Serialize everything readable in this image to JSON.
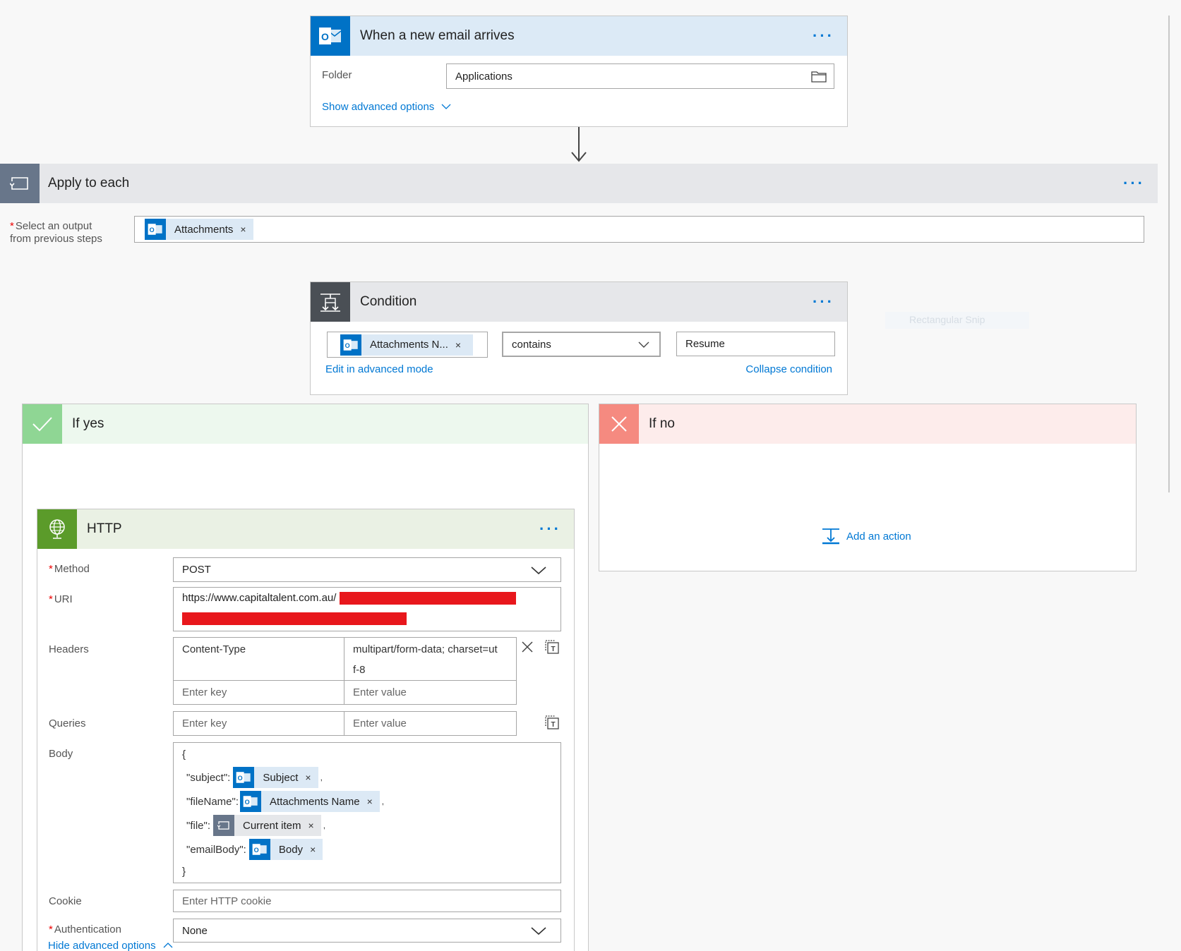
{
  "trigger": {
    "title": "When a new email arrives",
    "folder_label": "Folder",
    "folder_value": "Applications",
    "advanced_link": "Show advanced options"
  },
  "apply_each": {
    "title": "Apply to each",
    "select_label_line1": "Select an output",
    "select_label_line2": "from previous steps",
    "token": "Attachments"
  },
  "condition": {
    "title": "Condition",
    "token": "Attachments N...",
    "operator": "contains",
    "value": "Resume",
    "edit_link": "Edit in advanced mode",
    "collapse_link": "Collapse condition"
  },
  "ghost_text": "Rectangular Snip",
  "if_yes": {
    "title": "If yes"
  },
  "if_no": {
    "title": "If no",
    "add_action": "Add an action"
  },
  "http": {
    "title": "HTTP",
    "method_label": "Method",
    "method_value": "POST",
    "uri_label": "URI",
    "uri_value": "https://www.capitaltalent.com.au/",
    "headers_label": "Headers",
    "header_key": "Content-Type",
    "header_value_line1": "multipart/form-data; charset=ut",
    "header_value_line2": "f-8",
    "key_placeholder": "Enter key",
    "value_placeholder": "Enter value",
    "queries_label": "Queries",
    "body_label": "Body",
    "body_open": "{",
    "body_close": "}",
    "body_subject_key": "\"subject\":",
    "body_subject_token": "Subject",
    "body_filename_key": "\"fileName\":",
    "body_filename_token": "Attachments Name",
    "body_file_key": "\"file\":",
    "body_file_token": "Current item",
    "body_emailbody_key": "\"emailBody\":",
    "body_emailbody_token": "Body",
    "comma": ",",
    "cookie_label": "Cookie",
    "cookie_placeholder": "Enter HTTP cookie",
    "auth_label": "Authentication",
    "auth_value": "None",
    "hide_link": "Hide advanced options"
  },
  "colors": {
    "outlook_blue": "#0072c6",
    "link_blue": "#0078d4",
    "trigger_header": "#dceaf6",
    "gray_header": "#e6e7ea",
    "yes_green": "#8fd694",
    "no_red": "#f58a80",
    "http_green": "#5b9b2a",
    "redaction": "#e8171c"
  }
}
